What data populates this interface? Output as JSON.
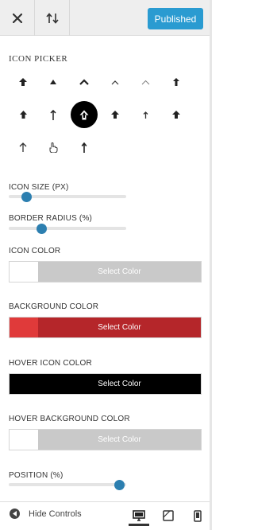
{
  "toolbar": {
    "close_icon": "close-icon",
    "sort_icon": "sort-arrows-icon",
    "publish_label": "Published",
    "publish_color": "#2a9bd1"
  },
  "icon_picker": {
    "title": "ICON PICKER",
    "icons": [
      "arrow-up-solid-icon",
      "triangle-up-small-icon",
      "chevron-up-bold-icon",
      "chevron-up-thin-icon",
      "chevron-up-light-icon",
      "arrow-up-small-icon",
      "arrow-up-block-icon",
      "arrow-up-long-icon",
      "arrow-up-circle-icon",
      "arrow-up-bold-icon",
      "arrow-up-narrow-icon",
      "arrow-up-fat-icon",
      "arrow-up-line-icon",
      "hand-pointing-up-icon",
      "arrow-up-bar-icon"
    ],
    "selected_index": 8
  },
  "controls": {
    "icon_size": {
      "label": "ICON SIZE (PX)",
      "value_fraction": 0.15
    },
    "border_radius": {
      "label": "BORDER RADIUS (%)",
      "value_fraction": 0.28
    },
    "icon_color": {
      "label": "ICON COLOR",
      "button": "Select Color",
      "swatch": "#ffffff",
      "button_bg": "#c9c9c9"
    },
    "background_color": {
      "label": "BACKGROUND COLOR",
      "button": "Select Color",
      "swatch": "#e03a3a",
      "button_bg": "#b5262a"
    },
    "hover_icon_color": {
      "label": "HOVER ICON COLOR",
      "button": "Select Color",
      "swatch": "#000000",
      "button_bg": "#000000"
    },
    "hover_background_color": {
      "label": "HOVER BACKGROUND COLOR",
      "button": "Select Color",
      "swatch": "#ffffff",
      "button_bg": "#c9c9c9"
    },
    "position": {
      "label": "POSITION (%)",
      "value_fraction": 0.94
    }
  },
  "footer": {
    "hide_controls": "Hide Controls",
    "devices": [
      "desktop-icon",
      "tablet-icon",
      "mobile-icon"
    ],
    "active_device": "desktop-icon"
  }
}
